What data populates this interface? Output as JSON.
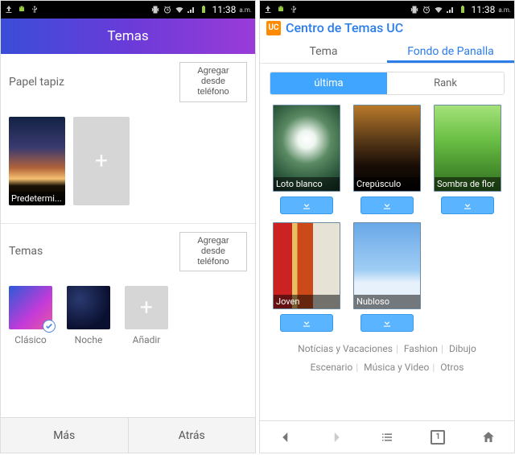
{
  "status": {
    "time": "11:38",
    "ampm": "a.m."
  },
  "left": {
    "header_title": "Temas",
    "wallpaper_section_title": "Papel tapiz",
    "add_from_phone": "Agregar desde teléfono",
    "wallpaper_default_label": "Predetermi...",
    "themes_section_title": "Temas",
    "themes": {
      "classic": "Clásico",
      "night": "Noche",
      "add": "Añadir"
    },
    "bottom": {
      "more": "Más",
      "back": "Atrás"
    }
  },
  "right": {
    "brand_badge": "UC",
    "title": "Centro de Temas UC",
    "tabs": {
      "tema": "Tema",
      "fondo": "Fondo de Panalla"
    },
    "segments": {
      "latest": "última",
      "rank": "Rank"
    },
    "wallpapers": {
      "loto": "Loto blanco",
      "crepusculo": "Crepúsculo",
      "sombra": "Sombra de flor",
      "joven": "Joven",
      "nubloso": "Nubloso"
    },
    "categories": {
      "noticias": "Notícias y Vacaciones",
      "fashion": "Fashion",
      "dibujo": "Dibujo",
      "escenario": "Escenario",
      "musica": "Música y Video",
      "otros": "Otros"
    },
    "tab_count": "1"
  }
}
